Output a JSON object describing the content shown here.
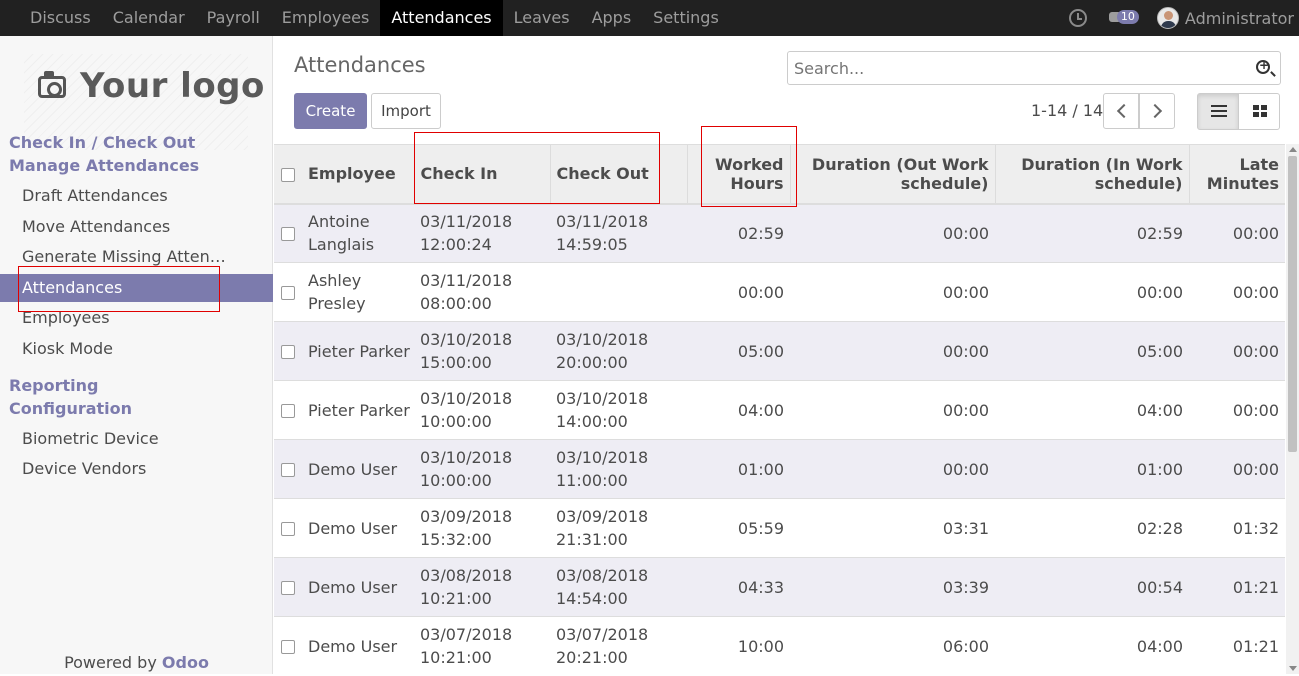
{
  "topbar": {
    "menu": [
      "Discuss",
      "Calendar",
      "Payroll",
      "Employees",
      "Attendances",
      "Leaves",
      "Apps",
      "Settings"
    ],
    "active_menu": "Attendances",
    "message_count": "10",
    "user": "Administrator"
  },
  "sidebar": {
    "logo_text": "Your logo",
    "section1": "Check In / Check Out",
    "section2": "Manage Attendances",
    "manage_items": [
      "Draft Attendances",
      "Move Attendances",
      "Generate Missing Attenda…",
      "Attendances",
      "Employees",
      "Kiosk Mode"
    ],
    "section3": "Reporting",
    "section4": "Configuration",
    "config_items": [
      "Biometric Device",
      "Device Vendors"
    ],
    "powered_prefix": "Powered by ",
    "powered_brand": "Odoo"
  },
  "control": {
    "title": "Attendances",
    "search_placeholder": "Search...",
    "create_label": "Create",
    "import_label": "Import",
    "pager": "1-14 / 14"
  },
  "table": {
    "headers": {
      "employee": "Employee",
      "check_in": "Check In",
      "check_out": "Check Out",
      "worked_hours_1": "Worked",
      "worked_hours_2": "Hours",
      "dur_out_1": "Duration (Out Work",
      "dur_out_2": "schedule)",
      "dur_in_1": "Duration (In Work",
      "dur_in_2": "schedule)",
      "late_1": "Late",
      "late_2": "Minutes"
    },
    "rows": [
      {
        "emp1": "Antoine",
        "emp2": "Langlais",
        "in_d": "03/11/2018",
        "in_t": "12:00:24",
        "out_d": "03/11/2018",
        "out_t": "14:59:05",
        "worked": "02:59",
        "dur_out": "00:00",
        "dur_in": "02:59",
        "late": "00:00"
      },
      {
        "emp1": "Ashley",
        "emp2": "Presley",
        "in_d": "03/11/2018",
        "in_t": "08:00:00",
        "out_d": "",
        "out_t": "",
        "worked": "00:00",
        "dur_out": "00:00",
        "dur_in": "00:00",
        "late": "00:00"
      },
      {
        "emp1": "Pieter Parker",
        "emp2": "",
        "in_d": "03/10/2018",
        "in_t": "15:00:00",
        "out_d": "03/10/2018",
        "out_t": "20:00:00",
        "worked": "05:00",
        "dur_out": "00:00",
        "dur_in": "05:00",
        "late": "00:00"
      },
      {
        "emp1": "Pieter Parker",
        "emp2": "",
        "in_d": "03/10/2018",
        "in_t": "10:00:00",
        "out_d": "03/10/2018",
        "out_t": "14:00:00",
        "worked": "04:00",
        "dur_out": "00:00",
        "dur_in": "04:00",
        "late": "00:00"
      },
      {
        "emp1": "Demo User",
        "emp2": "",
        "in_d": "03/10/2018",
        "in_t": "10:00:00",
        "out_d": "03/10/2018",
        "out_t": "11:00:00",
        "worked": "01:00",
        "dur_out": "00:00",
        "dur_in": "01:00",
        "late": "00:00"
      },
      {
        "emp1": "Demo User",
        "emp2": "",
        "in_d": "03/09/2018",
        "in_t": "15:32:00",
        "out_d": "03/09/2018",
        "out_t": "21:31:00",
        "worked": "05:59",
        "dur_out": "03:31",
        "dur_in": "02:28",
        "late": "01:32"
      },
      {
        "emp1": "Demo User",
        "emp2": "",
        "in_d": "03/08/2018",
        "in_t": "10:21:00",
        "out_d": "03/08/2018",
        "out_t": "14:54:00",
        "worked": "04:33",
        "dur_out": "03:39",
        "dur_in": "00:54",
        "late": "01:21"
      },
      {
        "emp1": "Demo User",
        "emp2": "",
        "in_d": "03/07/2018",
        "in_t": "10:21:00",
        "out_d": "03/07/2018",
        "out_t": "20:21:00",
        "worked": "10:00",
        "dur_out": "06:00",
        "dur_in": "04:00",
        "late": "01:21"
      }
    ]
  }
}
